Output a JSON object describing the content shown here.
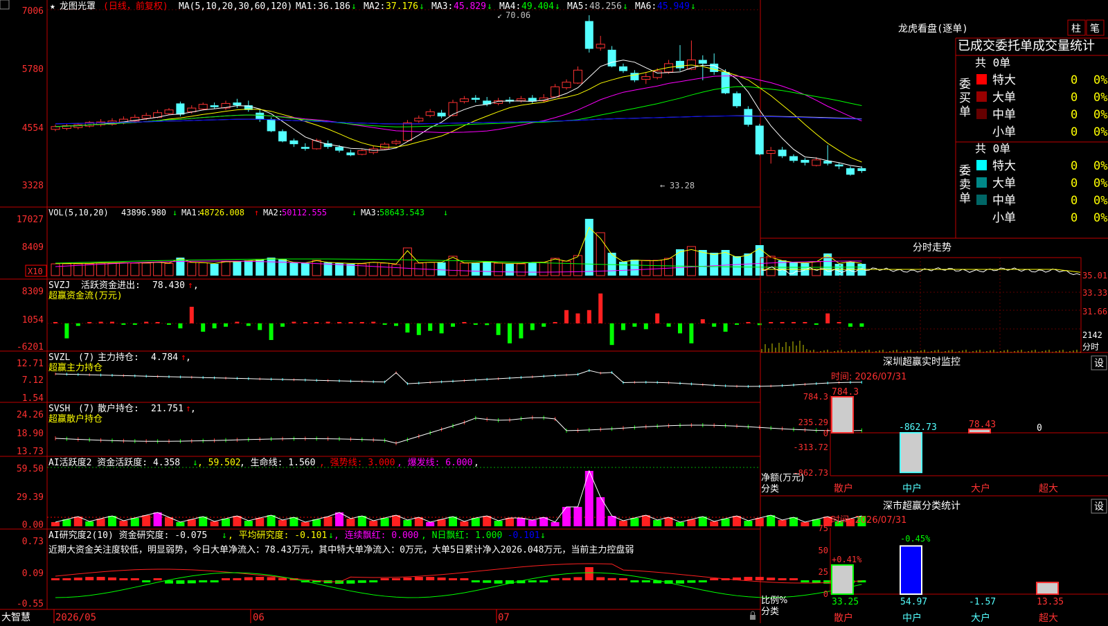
{
  "app": {
    "brand": "大智慧",
    "lock_icon": "lock-icon"
  },
  "main_chart": {
    "star": "★",
    "name": "龙图光罩",
    "mode": "(日线，前复权)",
    "ma_params": "MA(5,10,20,30,60,120)",
    "ma_values": [
      {
        "label": "MA1:",
        "value": "36.186",
        "trend": "↓",
        "color": "#ffffff"
      },
      {
        "label": "MA2:",
        "value": "37.176",
        "trend": "↓",
        "color": "#ffff00"
      },
      {
        "label": "MA3:",
        "value": "45.829",
        "trend": "↓",
        "color": "#ff00ff"
      },
      {
        "label": "MA4:",
        "value": "49.404",
        "trend": "↓",
        "color": "#00ff00"
      },
      {
        "label": "MA5:",
        "value": "48.256",
        "trend": "↓",
        "color": "#c0c0c0"
      },
      {
        "label": "MA6:",
        "value": "45.949",
        "trend": "↓",
        "color": "#0000ff"
      }
    ],
    "y_ticks": [
      "7006",
      "5780",
      "4554",
      "3328"
    ],
    "high_label": "70.06",
    "low_label": "33.28",
    "high_marker": "↙",
    "low_marker": "←",
    "hint_ma_pos": "lines"
  },
  "vol_panel": {
    "header": "VOL(5,10,20)",
    "value": "43896.980",
    "trend": "↓",
    "ma1_label": "MA1:",
    "ma1": "48726.008",
    "ma1_trend": "↑",
    "ma2_label": "MA2:",
    "ma2": "50112.555",
    "ma2_trend": "↓",
    "ma3_label": "MA3:",
    "ma3": "58643.543",
    "ma3_trend": "↓",
    "y_ticks": [
      "17027",
      "8409"
    ],
    "unit": "X10"
  },
  "svzj_panel": {
    "name": "SVZJ",
    "title": "活跃资金进出:",
    "value": "78.430",
    "trend": "↑",
    "suffix": ",",
    "subtitle": "超赢资金流(万元)",
    "y_ticks": [
      "8309",
      "1054",
      "-6201"
    ]
  },
  "svzl_panel": {
    "name": "SVZL",
    "param": "(7)",
    "title": "主力持仓:",
    "value": "4.784",
    "trend": "↑",
    "suffix": ",",
    "subtitle": "超赢主力持仓",
    "y_ticks": [
      "12.71",
      "7.12",
      "1.54"
    ]
  },
  "svsh_panel": {
    "name": "SVSH",
    "param": "(7)",
    "title": "散户持仓:",
    "value": "21.751",
    "trend": "↑",
    "suffix": ",",
    "subtitle": "超赢散户持仓",
    "y_ticks": [
      "24.26",
      "18.90",
      "13.73"
    ]
  },
  "ai_active_panel": {
    "header": "AI活跃度2 资金活跃度: 4.358",
    "trend": "↓",
    "val2": ", 59.502",
    "life_line": ", 生命线: 1.560",
    "strong_line": ", 强势线: 3.000",
    "burst_line": ", 爆发线: 6.000",
    "tail": ",",
    "y_ticks": [
      "59.50",
      "29.39",
      "0.00"
    ]
  },
  "ai_research_panel": {
    "header": "AI研究度2(10)  资金研究度: -0.075",
    "trend": "↓",
    "avg": ", 平均研究度: -0.101",
    "avg_trend": "↓",
    "red": ", 连续飘红: 0.000",
    "nday": ", N日飘红: 1.000",
    "last": ", -0.101",
    "last_trend": "↓",
    "comment": "近期大资金关注度较低，明显弱势，今日大单净流入：78.43万元，其中特大单净流入：0万元，大单5日累计净入2026.048万元，当前主力控盘弱",
    "y_ticks": [
      "0.73",
      "0.09",
      "-0.55"
    ]
  },
  "x_axis": {
    "labels": [
      "2026/05",
      "06",
      "07"
    ]
  },
  "right_panel": {
    "dragon_title": "龙虎看盘(逐单)",
    "btn_zhu": "柱",
    "btn_bi": "笔",
    "stats_title": "已成交委托单成交量统计",
    "buy_side": "委买单",
    "sell_side": "委卖单",
    "buy_total": "共 0单",
    "sell_total": "共 0单",
    "buy_rows": [
      {
        "label": "特大",
        "count": "0",
        "pct": "0%",
        "color": "#ff0000"
      },
      {
        "label": "大单",
        "count": "0",
        "pct": "0%",
        "color": "#990000"
      },
      {
        "label": "中单",
        "count": "0",
        "pct": "0%",
        "color": "#660000"
      },
      {
        "label": "小单",
        "count": "0",
        "pct": "0%",
        "color": "#000000"
      }
    ],
    "sell_rows": [
      {
        "label": "特大",
        "count": "0",
        "pct": "0%",
        "color": "#00ffff"
      },
      {
        "label": "大单",
        "count": "0",
        "pct": "0%",
        "color": "#008888"
      },
      {
        "label": "中单",
        "count": "0",
        "pct": "0%",
        "color": "#006666"
      },
      {
        "label": "小单",
        "count": "0",
        "pct": "0%",
        "color": "#000000"
      }
    ],
    "intraday_title": "分时走势",
    "intraday_ticks": [
      "35.01",
      "33.33",
      "31.66"
    ],
    "intraday_vol": "2142",
    "intraday_label": "分时",
    "monitor_title": "深圳超赢实时监控",
    "settings_btn": "设",
    "monitor_time": "时间: 2026/07/31",
    "monitor_ticks": [
      "784.3",
      "235.29",
      "0",
      "-313.72",
      "-862.73"
    ],
    "monitor_ylabel": "净额(万元)",
    "monitor_xlabel": "分类",
    "monitor_values": [
      "784.3",
      "-862.73",
      "78.43",
      "0"
    ],
    "monitor_cats": [
      "散户",
      "中户",
      "大户",
      "超大"
    ],
    "class_title": "深市超赢分类统计",
    "class_btn": "设",
    "class_time": "时间: 2026/07/31",
    "class_ticks": [
      "75",
      "50",
      "25",
      "0"
    ],
    "class_ylabel": "比例%",
    "class_xlabel": "分类",
    "class_top": [
      "+0.41%",
      "-0.45%"
    ],
    "class_values": [
      "33.25",
      "54.97",
      "-1.57",
      "13.35"
    ],
    "class_cats": [
      "散户",
      "中户",
      "大户",
      "超大"
    ]
  },
  "chart_data": {
    "type": "candlestick",
    "dates_axis": [
      "2026/05",
      "06",
      "07"
    ],
    "ylim": [
      3280,
      7006
    ],
    "price_scale_note": "axis shows price x100",
    "candles": [
      [
        4540,
        4600,
        4500,
        4640
      ],
      [
        4560,
        4620,
        4520,
        4660
      ],
      [
        4580,
        4640,
        4540,
        4680
      ],
      [
        4610,
        4690,
        4580,
        4720
      ],
      [
        4640,
        4700,
        4600,
        4760
      ],
      [
        4650,
        4720,
        4620,
        4780
      ],
      [
        4700,
        4760,
        4650,
        4820
      ],
      [
        4720,
        4800,
        4700,
        4860
      ],
      [
        4780,
        4840,
        4740,
        4900
      ],
      [
        4800,
        4900,
        4780,
        4960
      ],
      [
        4880,
        4960,
        4850,
        5000
      ],
      [
        5100,
        4860,
        4820,
        5140
      ],
      [
        4920,
        5000,
        4880,
        5060
      ],
      [
        4980,
        5080,
        4950,
        5120
      ],
      [
        5060,
        5020,
        4980,
        5120
      ],
      [
        5000,
        5100,
        4960,
        5160
      ],
      [
        5120,
        5060,
        5000,
        5200
      ],
      [
        5060,
        4960,
        4920,
        5160
      ],
      [
        4900,
        4760,
        4700,
        4960
      ],
      [
        4760,
        4500,
        4480,
        4800
      ],
      [
        4500,
        4280,
        4260,
        4540
      ],
      [
        4300,
        4220,
        4160,
        4340
      ],
      [
        4160,
        4120,
        4080,
        4240
      ],
      [
        4120,
        4300,
        4100,
        4340
      ],
      [
        4240,
        4160,
        4120,
        4300
      ],
      [
        4160,
        4080,
        4040,
        4200
      ],
      [
        4040,
        3980,
        3960,
        4100
      ],
      [
        4000,
        4080,
        3980,
        4120
      ],
      [
        4040,
        4120,
        4000,
        4180
      ],
      [
        4120,
        4220,
        4100,
        4260
      ],
      [
        4240,
        4280,
        4200,
        4320
      ],
      [
        4300,
        4680,
        4280,
        4740
      ],
      [
        4720,
        4780,
        4680,
        4840
      ],
      [
        4840,
        4920,
        4800,
        4980
      ],
      [
        4900,
        4820,
        4780,
        4960
      ],
      [
        4840,
        5120,
        4820,
        5180
      ],
      [
        5140,
        5200,
        5100,
        5260
      ],
      [
        5220,
        5180,
        5120,
        5280
      ],
      [
        5160,
        5080,
        5040,
        5240
      ],
      [
        5100,
        5160,
        5060,
        5220
      ],
      [
        5180,
        5140,
        5100,
        5240
      ],
      [
        5160,
        5200,
        5120,
        5260
      ],
      [
        5220,
        5140,
        5100,
        5280
      ],
      [
        5160,
        5220,
        5120,
        5300
      ],
      [
        5240,
        5460,
        5220,
        5520
      ],
      [
        5440,
        5560,
        5400,
        5620
      ],
      [
        5540,
        5820,
        5520,
        5900
      ],
      [
        6880,
        6280,
        6200,
        7006
      ],
      [
        6300,
        6380,
        6240,
        6560
      ],
      [
        6260,
        5900,
        5880,
        6340
      ],
      [
        5900,
        5800,
        5760,
        5960
      ],
      [
        5760,
        5600,
        5560,
        5820
      ],
      [
        5620,
        5680,
        5520,
        5760
      ],
      [
        5660,
        5800,
        5620,
        5860
      ],
      [
        5780,
        5960,
        5740,
        6040
      ],
      [
        6020,
        5860,
        5800,
        6360
      ],
      [
        5840,
        6040,
        5820,
        6460
      ],
      [
        6040,
        5960,
        5600,
        6140
      ],
      [
        5960,
        5780,
        5720,
        6180
      ],
      [
        5780,
        5320,
        5300,
        5840
      ],
      [
        5320,
        5040,
        5000,
        5360
      ],
      [
        4980,
        4640,
        4600,
        5040
      ],
      [
        4620,
        4000,
        3980,
        4660
      ],
      [
        4020,
        4080,
        3800,
        4160
      ],
      [
        4100,
        3960,
        3920,
        4160
      ],
      [
        3960,
        3860,
        3820,
        4000
      ],
      [
        3880,
        3820,
        3760,
        3920
      ],
      [
        3760,
        3880,
        3740,
        3940
      ],
      [
        3860,
        3800,
        3760,
        4200
      ],
      [
        3780,
        3740,
        3680,
        3820
      ],
      [
        3700,
        3560,
        3540,
        3740
      ],
      [
        3700,
        3640,
        3600,
        3740
      ]
    ],
    "series": [
      {
        "name": "MA1",
        "values": [
          36.186
        ]
      },
      {
        "name": "MA2",
        "values": [
          37.176
        ]
      },
      {
        "name": "MA3",
        "values": [
          45.829
        ]
      },
      {
        "name": "MA4",
        "values": [
          49.404
        ]
      },
      {
        "name": "MA5",
        "values": [
          48.256
        ]
      },
      {
        "name": "MA6",
        "values": [
          45.949
        ]
      }
    ]
  }
}
